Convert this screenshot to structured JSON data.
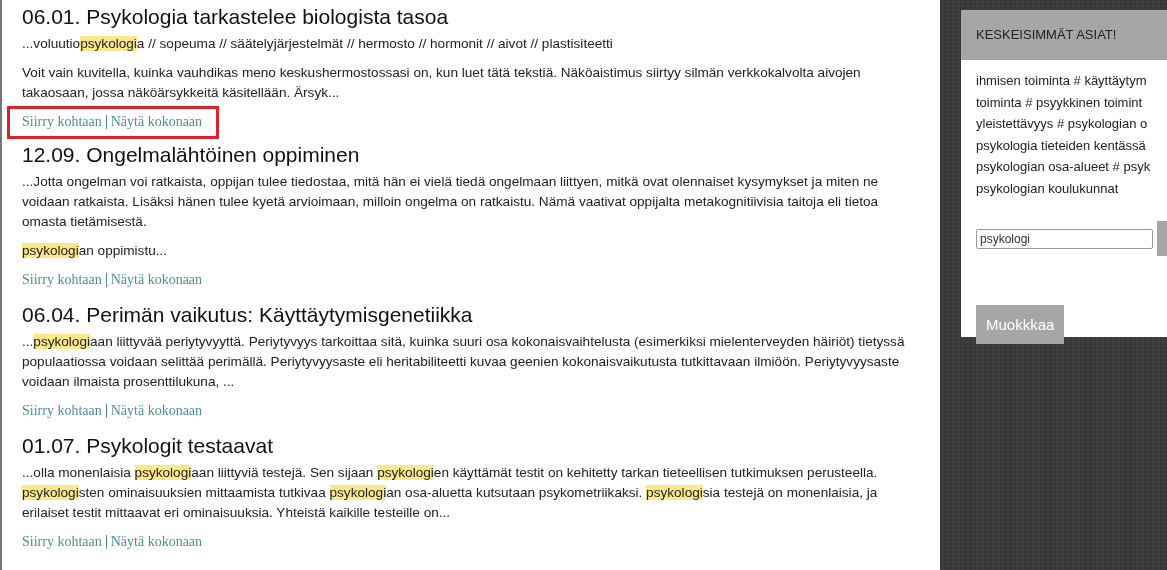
{
  "results": [
    {
      "title": "06.01. Psykologia tarkastelee biologista tasoa",
      "paragraphs": [
        [
          {
            "text": "...voluutio",
            "highlight": false
          },
          {
            "text": "psykologi",
            "highlight": true
          },
          {
            "text": "a // sopeuma // säätelyjärjestelmät // hermosto // hormonit // aivot // plastisiteetti",
            "highlight": false
          }
        ],
        [
          {
            "text": "Voit vain kuvitella, kuinka vauhdikas meno keskushermostossasi on, kun luet tätä tekstiä. Näköaistimus siirtyy silmän verkkokalvolta aivojen takaosaan, jossa näköärsykkeitä käsitellään. Ärsyk...",
            "highlight": false
          }
        ]
      ],
      "links": [
        "Siirry kohtaan",
        "Näytä kokonaan"
      ],
      "outlined": true
    },
    {
      "title": "12.09. Ongelmalähtöinen oppiminen",
      "paragraphs": [
        [
          {
            "text": "...Jotta ongelman voi ratkaista, oppijan tulee tiedostaa, mitä hän ei vielä tiedä ongelmaan liittyen, mitkä ovat olennaiset kysymykset ja miten ne voidaan ratkaista. Lisäksi hänen tulee kyetä arvioimaan, milloin ongelma on ratkaistu. Nämä vaativat oppijalta metakognitiivisia taitoja eli tietoa omasta tietämisestä.",
            "highlight": false
          }
        ],
        [
          {
            "text": "psykologi",
            "highlight": true
          },
          {
            "text": "an oppimistu...",
            "highlight": false
          }
        ]
      ],
      "links": [
        "Siirry kohtaan",
        "Näytä kokonaan"
      ],
      "outlined": false
    },
    {
      "title": "06.04. Perimän vaikutus: Käyttäytymisgenetiikka",
      "paragraphs": [
        [
          {
            "text": "...",
            "highlight": false
          },
          {
            "text": "psykologi",
            "highlight": true
          },
          {
            "text": "aan liittyvää periytyvyyttä. Periytyvyys tarkoittaa sitä, kuinka suuri osa kokonaisvaihtelusta (esimerkiksi mielenterveyden häiriöt) tietyssä populaatiossa voidaan selittää perimällä. Periytyvyysaste eli heritabiliteetti kuvaa geenien kokonaisvaikutusta tutkittavaan ilmiöön. Periytyvyysaste voidaan ilmaista prosenttilukuna, ...",
            "highlight": false
          }
        ]
      ],
      "links": [
        "Siirry kohtaan",
        "Näytä kokonaan"
      ],
      "outlined": false
    },
    {
      "title": "01.07. Psykologit testaavat",
      "paragraphs": [
        [
          {
            "text": "...olla monenlaisia ",
            "highlight": false
          },
          {
            "text": "psykologi",
            "highlight": true
          },
          {
            "text": "aan liittyviä testejä. Sen sijaan ",
            "highlight": false
          },
          {
            "text": "psykologi",
            "highlight": true
          },
          {
            "text": "en käyttämät testit on kehitetty tarkan tieteellisen tutkimuksen perusteella. ",
            "highlight": false
          },
          {
            "text": "psykologi",
            "highlight": true
          },
          {
            "text": "sten ominaisuuksien mittaamista tutkivaa ",
            "highlight": false
          },
          {
            "text": "psykologi",
            "highlight": true
          },
          {
            "text": "an osa-aluetta kutsutaan psykometriikaksi. ",
            "highlight": false
          },
          {
            "text": "psykologi",
            "highlight": true
          },
          {
            "text": "sia testejä on monenlaisia, ja erilaiset testit mittaavat eri ominaisuuksia. Yhteistä kaikille testeille on...",
            "highlight": false
          }
        ]
      ],
      "links": [
        "Siirry kohtaan",
        "Näytä kokonaan"
      ],
      "outlined": false
    }
  ],
  "sidebar": {
    "title": "KESKEISIMMÄT ASIAT!",
    "lines": [
      "ihmisen toiminta # käyttäytym",
      "toiminta # psyykkinen toimint",
      "yleistettävyys # psykologian o",
      "psykologia tieteiden kentässä",
      "psykologian osa-alueet # psyk",
      "psykologian koulukunnat"
    ],
    "search": {
      "value": "psykologi"
    },
    "edit_button": "Muokkkaa"
  }
}
